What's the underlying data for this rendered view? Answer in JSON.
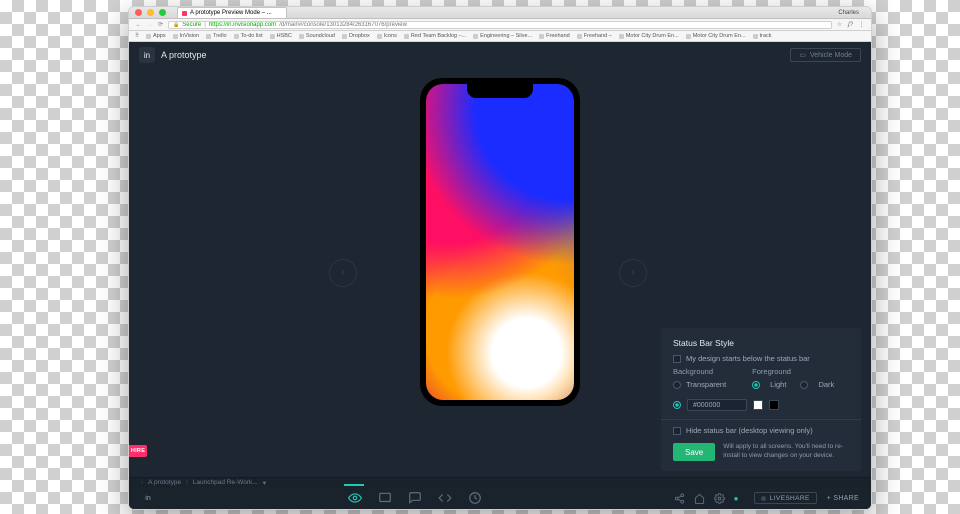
{
  "browser": {
    "traffic": [
      "close",
      "minimize",
      "zoom"
    ],
    "tab_title": "A prototype Preview Mode – ...",
    "user": "Charles",
    "secure": "Secure",
    "host": "https://in.invisionapp.com",
    "path": "/d/main#/console/13013284/263167076/preview",
    "star_icon": "star-icon",
    "menu_icon": "kebab-icon",
    "bookmarks": [
      "Apps",
      "InVision",
      "Trello",
      "To-do list",
      "HSBC",
      "Soundcloud",
      "Dropbox",
      "Icons",
      "Red Team Backlog –...",
      "Engineering – Silve...",
      "Freehand",
      "Freehand –",
      "Motor City Drum En...",
      "Motor City Drum En...",
      "track"
    ]
  },
  "app": {
    "logo": "in",
    "title": "A prototype",
    "vehicle_btn": "Vehicle Mode",
    "hire": "HIRE",
    "breadcrumb": {
      "root": "A prototype",
      "screen": "Launchpad Re-Work...",
      "caret": "▾"
    },
    "toolbar": {
      "icons": [
        "preview",
        "rect",
        "comment",
        "code",
        "history"
      ],
      "right_icons": [
        "share-net",
        "home",
        "gear",
        "dot"
      ],
      "live": "LIVESHARE",
      "share": "SHARE"
    }
  },
  "panel": {
    "title": "Status Bar Style",
    "chk1": "My design starts below the status bar",
    "bg_label": "Background",
    "fg_label": "Foreground",
    "bg_opts": [
      "Transparent"
    ],
    "fg_opts": [
      "Light",
      "Dark"
    ],
    "hex": "#000000",
    "chk2": "Hide status bar (desktop viewing only)",
    "save": "Save",
    "save_note": "Will apply to all screens. You'll need to re-install to view changes on your device."
  }
}
